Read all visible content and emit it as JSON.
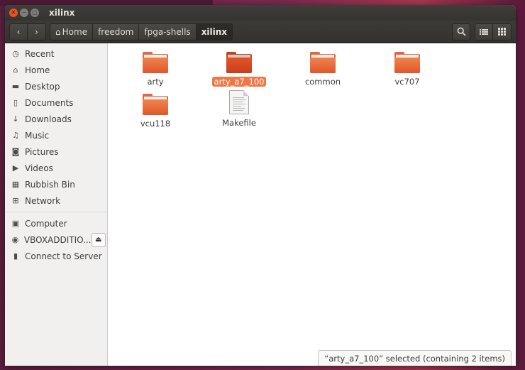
{
  "window": {
    "title": "xilinx"
  },
  "toolbar": {
    "back_icon": "chevron-left-icon",
    "forward_icon": "chevron-right-icon",
    "breadcrumbs": [
      {
        "label": "Home",
        "icon": "home-icon"
      },
      {
        "label": "freedom"
      },
      {
        "label": "fpga-shells"
      },
      {
        "label": "xilinx",
        "active": true
      }
    ]
  },
  "sidebar": {
    "items": [
      {
        "label": "Recent",
        "icon": "clock-icon"
      },
      {
        "label": "Home",
        "icon": "home-icon"
      },
      {
        "label": "Desktop",
        "icon": "desktop-folder-icon"
      },
      {
        "label": "Documents",
        "icon": "document-icon"
      },
      {
        "label": "Downloads",
        "icon": "download-icon"
      },
      {
        "label": "Music",
        "icon": "music-icon"
      },
      {
        "label": "Pictures",
        "icon": "camera-icon"
      },
      {
        "label": "Videos",
        "icon": "video-icon"
      },
      {
        "label": "Rubbish Bin",
        "icon": "trash-icon"
      },
      {
        "label": "Network",
        "icon": "network-icon"
      }
    ],
    "devices": [
      {
        "label": "Computer",
        "icon": "computer-icon"
      },
      {
        "label": "VBOXADDITIO...",
        "icon": "disc-icon",
        "eject": true
      },
      {
        "label": "Connect to Server",
        "icon": "server-icon"
      }
    ]
  },
  "files": [
    {
      "name": "arty",
      "type": "folder",
      "selected": false
    },
    {
      "name": "arty_a7_100",
      "type": "folder",
      "selected": true
    },
    {
      "name": "common",
      "type": "folder",
      "selected": false
    },
    {
      "name": "vc707",
      "type": "folder",
      "selected": false
    },
    {
      "name": "vcu118",
      "type": "folder",
      "selected": false
    },
    {
      "name": "Makefile",
      "type": "file",
      "selected": false
    }
  ],
  "status": {
    "text": "“arty_a7_100” selected  (containing 2 items)"
  },
  "colors": {
    "accent": "#e95420",
    "selection": "#f07746",
    "titlebar": "#3c3b37"
  }
}
